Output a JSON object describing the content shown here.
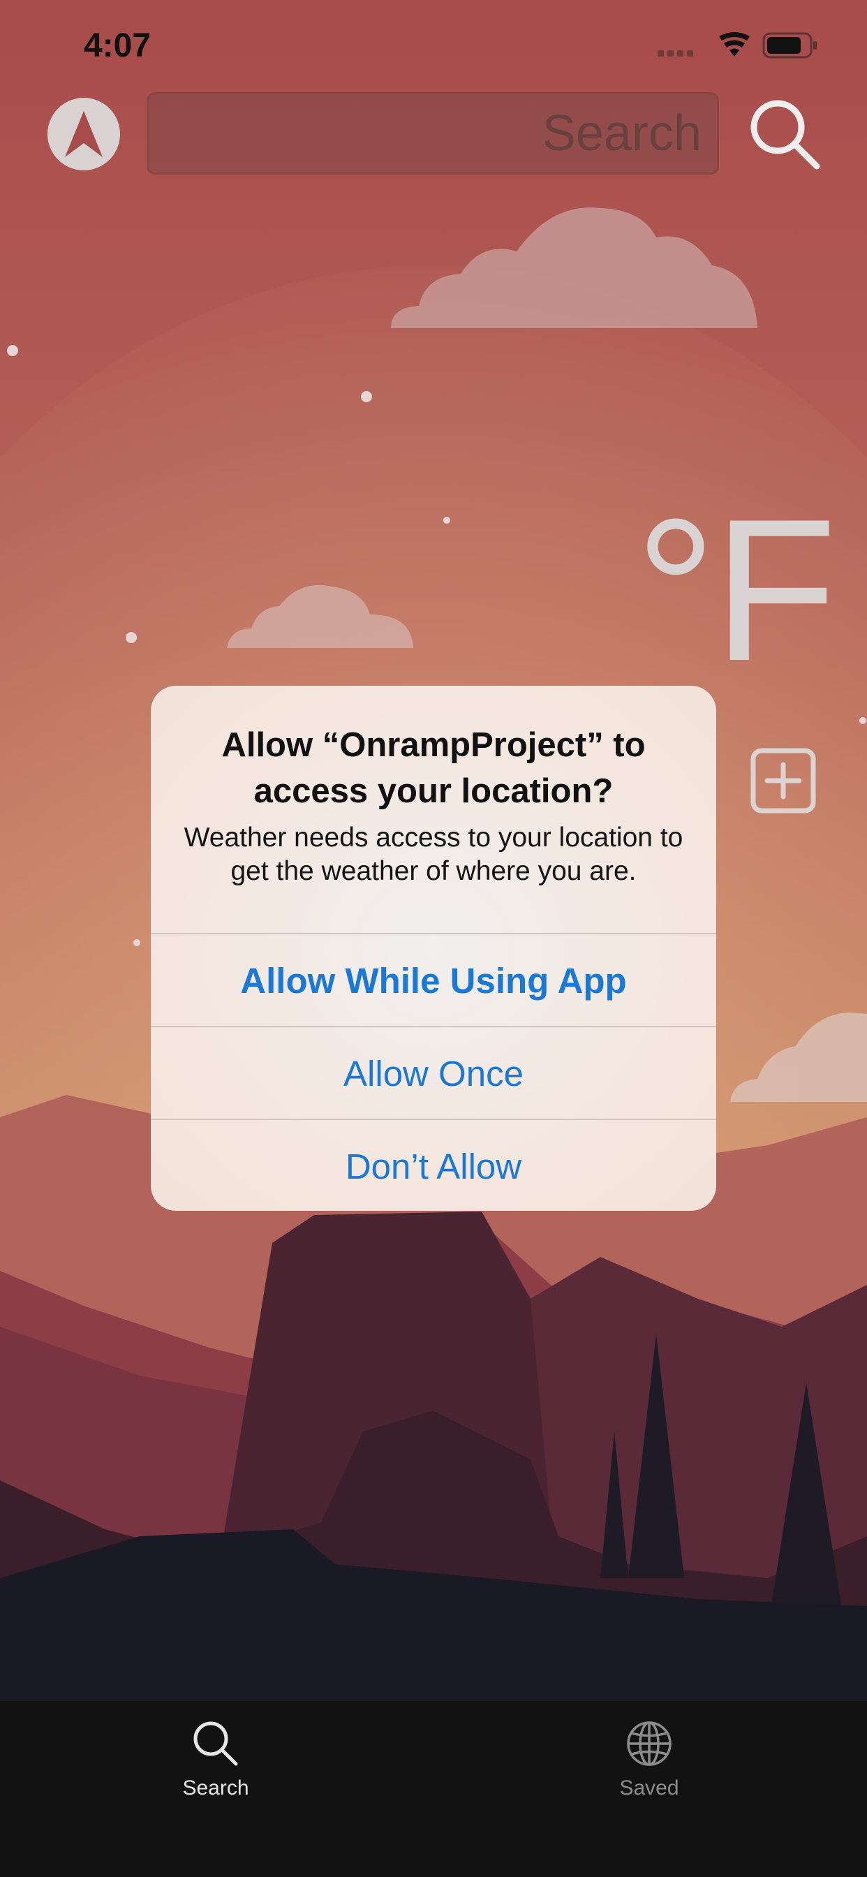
{
  "status_bar": {
    "time": "4:07"
  },
  "header": {
    "search_placeholder": "Search",
    "location_icon": "location-arrow-icon",
    "search_icon": "magnifier-icon"
  },
  "weather": {
    "unit_label": "°F",
    "add_icon": "plus-square-icon"
  },
  "alert": {
    "title": "Allow “OnrampProject” to access your location?",
    "message": "Weather needs access to your location to get the weather of where you are.",
    "buttons": [
      "Allow While Using App",
      "Allow Once",
      "Don’t Allow"
    ],
    "button_color": "#1a78d6"
  },
  "tab_bar": {
    "tabs": [
      {
        "label": "Search",
        "icon": "magnifier-icon",
        "active": true
      },
      {
        "label": "Saved",
        "icon": "globe-icon",
        "active": false
      }
    ],
    "active_color": "#e6e6e6",
    "inactive_color": "#8c8c8c"
  }
}
